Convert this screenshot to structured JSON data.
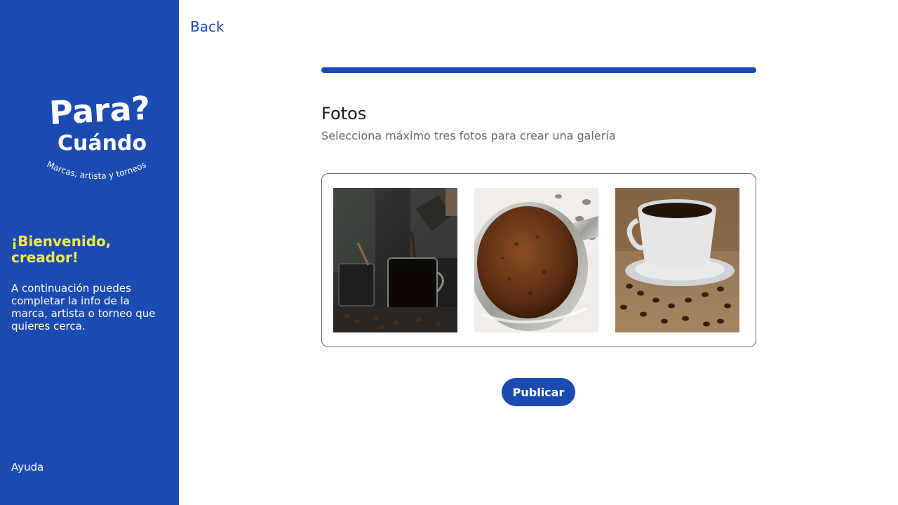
{
  "sidebar": {
    "logo": {
      "line1": "Para?",
      "line2": "Cuándo",
      "tagline": "Marcas, artista y torneos"
    },
    "welcome_title": "¡Bienvenido, creador!",
    "welcome_text": "A continuación puedes completar la info de la marca, artista o torneo que quieres cerca.",
    "help_label": "Ayuda"
  },
  "header": {
    "back_label": "Back"
  },
  "progress": {
    "value_percent": 100
  },
  "form": {
    "title": "Fotos",
    "subtitle": "Selecciona máximo tres fotos para crear una galería",
    "photos": [
      {
        "icon": "coffee-pour-photo"
      },
      {
        "icon": "ground-coffee-photo"
      },
      {
        "icon": "coffee-cup-photo"
      }
    ],
    "publish_label": "Publicar"
  },
  "colors": {
    "primary": "#1b4bb0",
    "accent": "#f2e94e",
    "text_dark": "#1c1c1c",
    "text_muted": "#6b6b6b"
  }
}
